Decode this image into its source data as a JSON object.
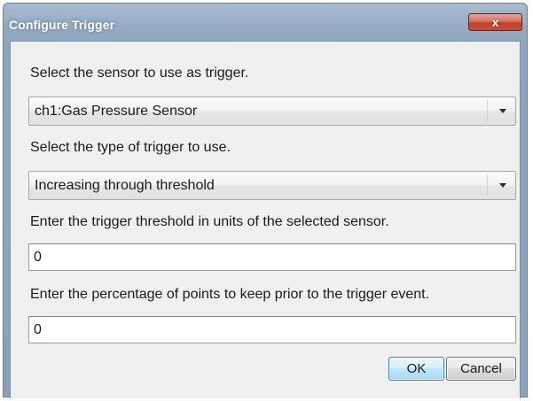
{
  "window": {
    "title": "Configure Trigger",
    "close_icon": "close-x-icon",
    "close_glyph": "x"
  },
  "form": {
    "sensor_label": "Select the sensor to use as trigger.",
    "sensor_value": "ch1:Gas Pressure Sensor",
    "trigger_type_label": "Select the type of trigger to use.",
    "trigger_type_value": "Increasing through threshold",
    "threshold_label": "Enter the trigger threshold in units of the selected sensor.",
    "threshold_value": "0",
    "percentage_label": "Enter the percentage of points to keep prior to the trigger event.",
    "percentage_value": "0"
  },
  "buttons": {
    "ok_label": "OK",
    "cancel_label": "Cancel"
  },
  "colors": {
    "titlebar": "#95abc3",
    "close_button": "#c94e37",
    "ok_button_accent": "#3c7fb1",
    "client_background": "#f0f0f0"
  }
}
